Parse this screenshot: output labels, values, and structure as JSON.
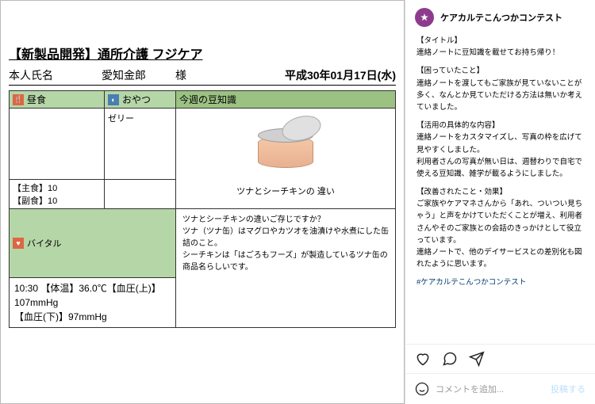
{
  "document": {
    "title": "【新製品開発】通所介護 フジケア",
    "person_label": "本人氏名",
    "person_name": "愛知金郎",
    "person_suffix": "様",
    "date": "平成30年01月17日(水)",
    "lunch_header": "昼食",
    "snack_header": "おやつ",
    "trivia_header": "今週の豆知識",
    "snack_value": "ゼリー",
    "staple_line": "【主食】10",
    "side_line": "【副食】10",
    "trivia_caption": "ツナとシーチキンの 違い",
    "vitals_header": "バイタル",
    "vitals_line1": "10:30 【体温】36.0℃【血圧(上)】107mmHg",
    "vitals_line2": "【血圧(下)】97mmHg",
    "trivia_text1": "ツナとシーチキンの違いご存じですか？",
    "trivia_text2": "ツナ（ツナ缶）はマグロやカツオを油漬けや水煮にした缶詰のこと。",
    "trivia_text3": "シーチキンは「はごろもフーズ」が製造しているツナ缶の商品名らしいです。"
  },
  "post": {
    "username": "ケアカルテこんつかコンテスト",
    "s1_title": "【タイトル】",
    "s1_body": "連絡ノートに豆知識を載せてお持ち帰り！",
    "s2_title": "【困っていたこと】",
    "s2_body": "連絡ノートを渡してもご家族が見ていないことが多く、なんとか見ていただける方法は無いか考えていました。",
    "s3_title": "【活用の具体的な内容】",
    "s3_body1": "連絡ノートをカスタマイズし、写真の枠を広げて見やすくしました。",
    "s3_body2": "利用者さんの写真が無い日は、週替わりで自宅で使える豆知識、雑学が載るようにしました。",
    "s4_title": "【改善されたこと・効果】",
    "s4_body1": "ご家族やケアマネさんから「あれ、ついつい見ちゃう」と声をかけていただくことが増え、利用者さんやそのご家族との会話のきっかけとして役立っています。",
    "s4_body2": "連絡ノートで、他のデイサービスとの差別化も図れたように思います。",
    "hashtag": "#ケアカルテこんつかコンテスト",
    "comment_placeholder": "コメントを追加...",
    "post_button": "投稿する"
  }
}
